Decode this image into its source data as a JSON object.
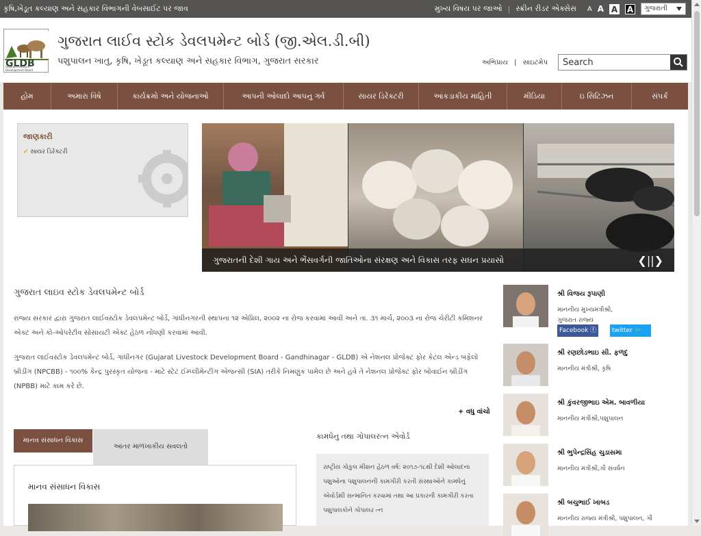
{
  "topbar": {
    "left_link": "કૃષિ,ખેડૂત કલ્યાણ અને સહકાર વિભાગની વેબસાઈટ પર જાવ",
    "main_content": "મુખ્ય વિષય પર જાઓ",
    "screen_reader": "સ્ક્રીન રીડર એક્સેસ",
    "font_a1": "A",
    "font_a2": "A",
    "font_a3": "A",
    "font_a4": "A",
    "language": "ગુજરાતી"
  },
  "header": {
    "logo_text": "GLDB",
    "logo_subtext": "Gujarat Livestock Development Board",
    "title": "ગુજરાત લાઈવ સ્ટોક ડેવલપમેન્ટ બોર્ડ (જી.એલ.ડી.બી)",
    "subtitle": "પશુપાલન ખાતુ, કૃષિ, ખેડૂત કલ્યાણ અને સહકાર વિભાગ, ગુજરાત સરકાર",
    "link_feedback": "અભિપ્રાય",
    "link_sitemap": "સાઇટમેપ",
    "search_placeholder": "Search"
  },
  "nav": [
    "હોમ",
    "અમારા વિષે",
    "કાર્યક્રમો અને યોજનાઓ",
    "આપની ઓલાદો આપનુ ગર્વ",
    "સાયર ડિરેક્ટરી",
    "આંકડાકીય માહિતી",
    "મીડિયા",
    "ઇ સિટિઝન",
    "સંપર્ક"
  ],
  "infobox": {
    "heading": "જાણકારી",
    "item": "સાયર ડિરેક્ટરી"
  },
  "banner": {
    "caption": "ગુજરાતની દેશી ગાય અને ભેંસવર્ગની જાતિઓના સંરક્ષણ અને વિકાસ તરફ સઘન પ્રયાસો",
    "controls": "❮||❯"
  },
  "about": {
    "heading": "ગુજરાત લાઇવ સ્ટોક ડેવલપમેન્ટ બોર્ડ",
    "para1": "રાજ્ય સરકાર દ્વારા ગુજરાત લાઈવસ્ટોક ડેવલપમેન્ટ બોર્ડ, ગાંધીનગરની સ્થાપના ૧૨ એપ્રિલ, ૨૦૦૨ ના રોજ કરવામાં આવી અને તા. ૩૧ માર્ચ, ૨૦૦૩ ના રોજ ચેરીટી કમિશનર એક્ટ અને કો-ઓપરેટીવ સોસાયટી એક્ટ હેઠળ નોંધણી કરવામાં આવી.",
    "para2": "ગુજરાત લાઈવસ્ટોક ડેવલપમેન્ટ બોર્ડ, ગાંધીનગર (Gujarat Livestock Development Board - Gandhinagar - GLDB) એ નેશનલ પ્રોજેક્ટ ફોર કેટલ એન્ડ બફેલો બ્રીડીંગ (NPCBB) - ૧૦૦% કેન્દ્ર પુરસ્કૃત યોજના - માટે સ્ટેટ ઈમ્પ્લીમેન્ટીંગ એજન્સી (SIA) તરીકે નિમણુંક પામેલ છે અને હવે તે નેશનલ પ્રોજેક્ટ ફોર બોવાઈન બ્રીડીંગ (NPBB) માટે કામ કરે છે.",
    "more": "+ વધુ વાંચો"
  },
  "tabs": {
    "tab1": "માનવ સંસાધન વિકાસ",
    "tab2": "આંતર માળખાકીય સવલતો",
    "panel_title": "માનવ સંસાધન વિકાસ"
  },
  "award": {
    "heading": "કામધેનુ તથા ગોપાલરત્ન એવોર્ડ",
    "text": "રાષ્ટ્રીય ગોકુલ મીશન હેઠળ વર્ષ: ૨૦૧૭-૧૮થી દેશી ઓલાદના પશુઓના પશુપાલનની કામગીરી કરતી સંસ્થાઓને કામધેનું એવોર્ડથી સન્માનિત કરવામાં તથા આ પ્રકારની કામગીરી કરતા પશુપાલકોને ગોપાલર ત્ન"
  },
  "people": [
    {
      "name": "શ્રી વિજય રૂપાણી",
      "role": "માનનીય મુખ્યમંત્રીશ્રી,",
      "role2": "ગુજરાત રાજ્ય"
    },
    {
      "name": "શ્રી રણછોડભાઇ સી. ફળદુ",
      "role": "માનનીય મંત્રીશ્રી, કૃષિ",
      "role2": ""
    },
    {
      "name": "શ્રી કુંવરજીભાઇ એમ. બાવળીયા",
      "role": "માનનીય મંત્રીશ્રી,પશુપાલન",
      "role2": ""
    },
    {
      "name": "શ્રી ભુપેન્દ્રસિંહ ચુડાસમા",
      "role": "માનનીય મંત્રીશ્રી,ગૌ સંવર્ધન",
      "role2": ""
    },
    {
      "name": "શ્રી બચુભાઈ ખાબડ",
      "role": "માનનીય રાજ્ય મંત્રીશ્રી, પશુપાલન, ગૌ",
      "role2": ""
    }
  ],
  "social": {
    "facebook": "Facebook",
    "twitter": "twitter",
    "facebook_color": "#3b5998",
    "twitter_color": "#1da1f2"
  },
  "colors": {
    "nav": "#7a5040",
    "topbar": "#555452"
  }
}
